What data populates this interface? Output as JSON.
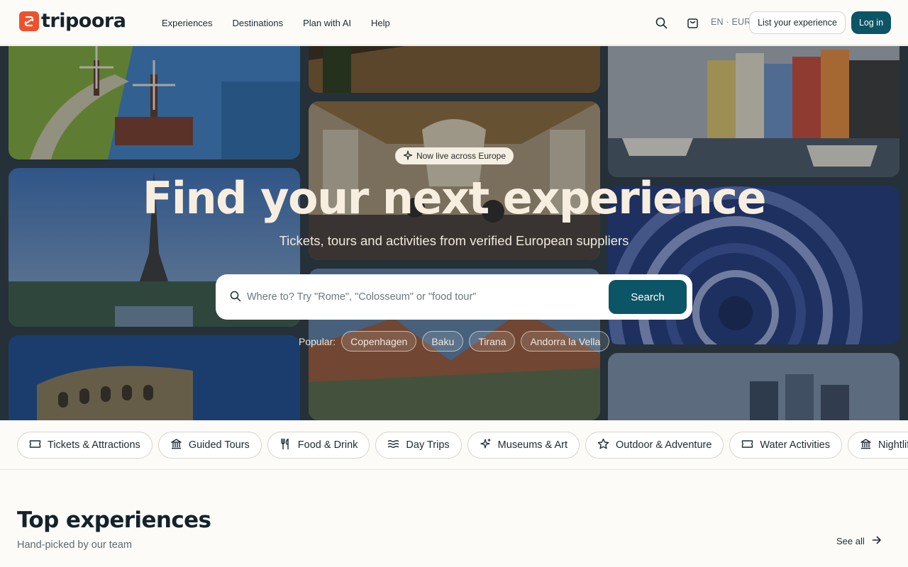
{
  "header": {
    "brand": "tripoora",
    "nav": [
      "Experiences",
      "Destinations",
      "Plan with AI",
      "Help"
    ],
    "lang_currency": "EN · EUR",
    "list_button": "List your experience",
    "login_button": "Log in",
    "icons": [
      "search-icon",
      "cart-icon"
    ]
  },
  "hero": {
    "badge": "Now live across Europe",
    "title": "Find your next experience",
    "subtitle": "Tickets, tours and activities from verified European suppliers",
    "search": {
      "placeholder": "Where to? Try \"Rome\", \"Colosseum\" or \"food tour\"",
      "value": "",
      "button": "Search"
    },
    "popular_label": "Popular:",
    "popular": [
      "Copenhagen",
      "Baku",
      "Tirana",
      "Andorra la Vella"
    ]
  },
  "categories": [
    {
      "label": "Tickets & Attractions",
      "icon": "ticket-icon"
    },
    {
      "label": "Guided Tours",
      "icon": "landmark-icon"
    },
    {
      "label": "Food & Drink",
      "icon": "utensils-icon"
    },
    {
      "label": "Day Trips",
      "icon": "waves-icon"
    },
    {
      "label": "Museums & Art",
      "icon": "sparkles-icon"
    },
    {
      "label": "Outdoor & Adventure",
      "icon": "star-icon"
    },
    {
      "label": "Water Activities",
      "icon": "ticket-icon"
    },
    {
      "label": "Nightlife",
      "icon": "landmark-icon"
    }
  ],
  "section": {
    "title": "Top experiences",
    "subtitle": "Hand-picked by our team",
    "see_all": "See all"
  },
  "colors": {
    "accent": "#0c5566",
    "brand": "#f0502c",
    "background": "#fcfbf8"
  }
}
